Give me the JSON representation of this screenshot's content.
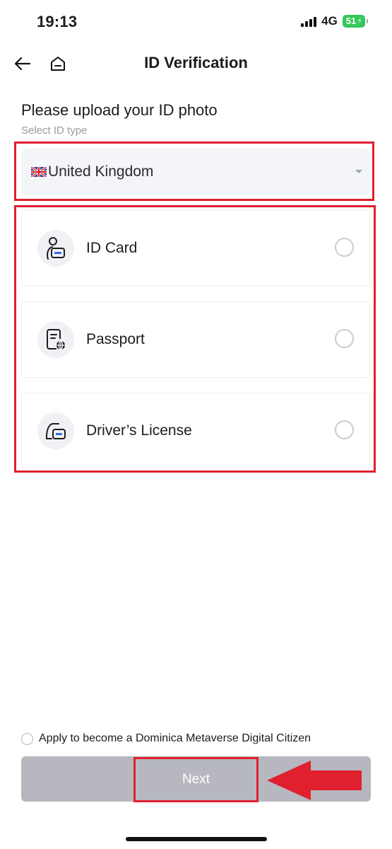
{
  "status_bar": {
    "time": "19:13",
    "network": "4G",
    "battery": "51"
  },
  "header": {
    "title": "ID Verification",
    "back_icon": "arrow-left-icon",
    "home_icon": "home-icon"
  },
  "form": {
    "heading": "Please upload your ID photo",
    "select_label": "Select ID type",
    "country": {
      "value": "United Kingdom",
      "flag_icon": "uk-flag-icon"
    },
    "options": [
      {
        "label": "ID Card",
        "icon": "id-card-icon",
        "selected": false
      },
      {
        "label": "Passport",
        "icon": "passport-icon",
        "selected": false
      },
      {
        "label": "Driver’s License",
        "icon": "drivers-license-icon",
        "selected": false
      }
    ]
  },
  "footer": {
    "citizen_label": "Apply to become a Dominica Metaverse Digital Citizen",
    "next_label": "Next"
  },
  "colors": {
    "highlight": "#e0202f",
    "button_disabled": "#b7b8bf",
    "battery": "#34c759"
  }
}
